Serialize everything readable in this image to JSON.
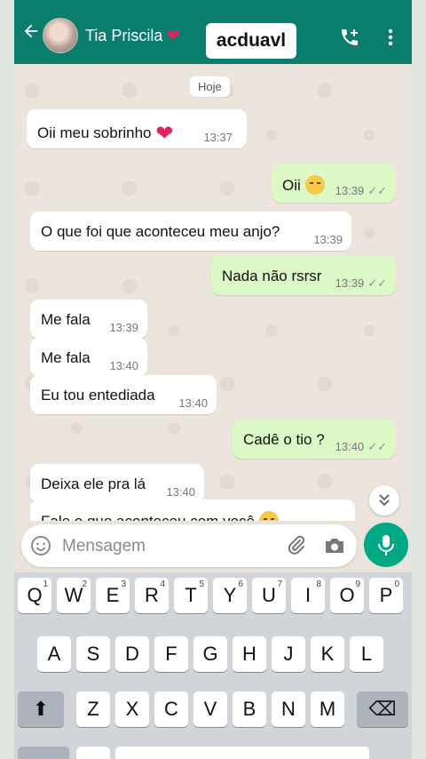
{
  "header": {
    "contact_name": "Tia Priscila",
    "heart_emoji": "❤",
    "overlay_tag": "acduavl",
    "colors": {
      "bar": "#0b7d6d"
    }
  },
  "chat": {
    "date_label": "Hoje",
    "messages": [
      {
        "dir": "in",
        "text": "Oii meu sobrinho",
        "emoji": "heart",
        "time": "13:37"
      },
      {
        "dir": "out",
        "text": "Oii",
        "emoji": "sweat-face",
        "time": "13:39",
        "ticks": "✓✓"
      },
      {
        "dir": "in",
        "text": "O que foi que aconteceu meu anjo?",
        "time": "13:39"
      },
      {
        "dir": "out",
        "text": "Nada não rsrsr",
        "time": "13:39",
        "ticks": "✓✓"
      },
      {
        "dir": "in",
        "text": "Me fala",
        "time": "13:39"
      },
      {
        "dir": "in",
        "text": "Me fala",
        "time": "13:40"
      },
      {
        "dir": "in",
        "text": "Eu tou entediada",
        "time": "13:40"
      },
      {
        "dir": "out",
        "text": "Cadê o tio ?",
        "time": "13:40",
        "ticks": "✓✓"
      },
      {
        "dir": "in",
        "text": "Deixa ele pra lá",
        "time": "13:40"
      },
      {
        "dir": "in",
        "text": "Fale o que aconteceu com você",
        "emoji": "smile-face"
      }
    ]
  },
  "composer": {
    "placeholder": "Mensagem"
  },
  "keyboard": {
    "row1": [
      {
        "key": "Q",
        "sup": "1"
      },
      {
        "key": "W",
        "sup": "2"
      },
      {
        "key": "E",
        "sup": "3"
      },
      {
        "key": "R",
        "sup": "4"
      },
      {
        "key": "T",
        "sup": "5"
      },
      {
        "key": "Y",
        "sup": "6"
      },
      {
        "key": "U",
        "sup": "7"
      },
      {
        "key": "I",
        "sup": "8"
      },
      {
        "key": "O",
        "sup": "9"
      },
      {
        "key": "P",
        "sup": "0"
      }
    ],
    "row2": [
      "A",
      "S",
      "D",
      "F",
      "G",
      "H",
      "J",
      "K",
      "L"
    ],
    "row3": [
      "Z",
      "X",
      "C",
      "V",
      "B",
      "N",
      "M"
    ],
    "shift_glyph": "⬆",
    "backspace_glyph": "⌫"
  }
}
